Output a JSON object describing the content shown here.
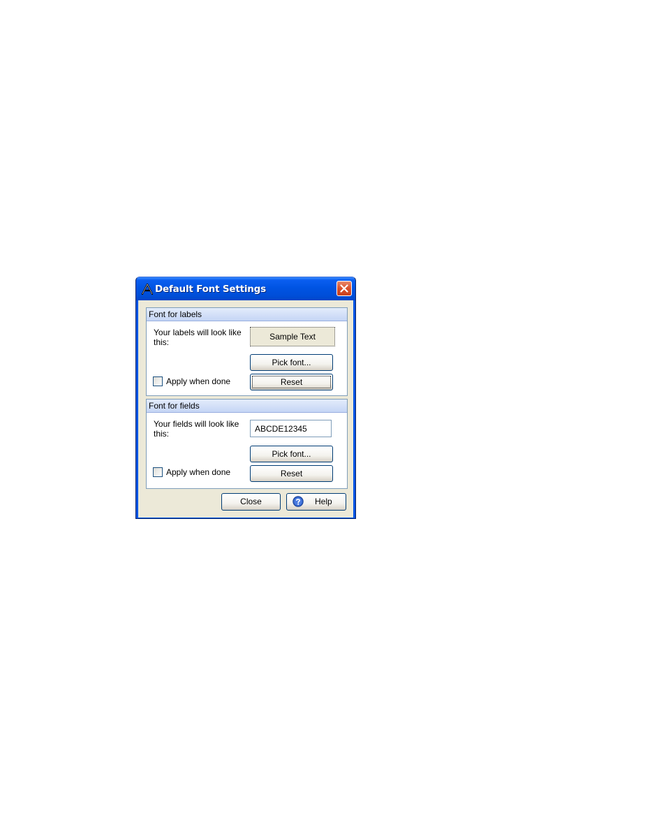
{
  "dialog": {
    "title": "Default Font Settings",
    "close_icon": "close-icon",
    "app_icon": "app-logo-icon"
  },
  "labels_group": {
    "header": "Font for labels",
    "description": "Your labels will look like this:",
    "sample_text": "Sample Text",
    "pick_font_label": "Pick font...",
    "reset_label": "Reset",
    "apply_label": "Apply when done",
    "apply_checked": false
  },
  "fields_group": {
    "header": "Font for fields",
    "description": "Your fields will look like this:",
    "sample_value": "ABCDE12345",
    "pick_font_label": "Pick font...",
    "reset_label": "Reset",
    "apply_label": "Apply when done",
    "apply_checked": false
  },
  "footer": {
    "close_label": "Close",
    "help_label": "Help",
    "help_icon": "help-icon"
  },
  "colors": {
    "titlebar": "#0054e3",
    "dialog_bg": "#ece9d8",
    "group_border": "#7f9db9",
    "group_header": "#c5d5f5",
    "close_button": "#d9502a"
  }
}
